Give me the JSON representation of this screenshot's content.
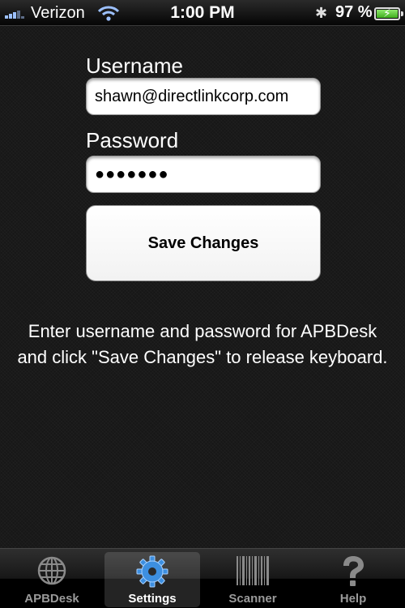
{
  "status_bar": {
    "carrier": "Verizon",
    "time": "1:00 PM",
    "battery_text": "97 %",
    "battery_level": 0.97,
    "bluetooth_glyph": "✱"
  },
  "form": {
    "username_label": "Username",
    "username_value": "shawn@directlinkcorp.com",
    "password_label": "Password",
    "password_value": "●●●●●●●",
    "save_button_label": "Save Changes",
    "instructions": "Enter username and password for APBDesk and click \"Save Changes\" to release keyboard."
  },
  "tab_bar": {
    "tabs": [
      {
        "label": "APBDesk",
        "icon": "globe-icon",
        "active": false
      },
      {
        "label": "Settings",
        "icon": "gear-icon",
        "active": true
      },
      {
        "label": "Scanner",
        "icon": "barcode-icon",
        "active": false
      },
      {
        "label": "Help",
        "icon": "question-mark-icon",
        "active": false
      }
    ]
  },
  "colors": {
    "background": "#171717",
    "battery_green": "#3fae1e",
    "settings_icon_blue": "#3d8fe0"
  }
}
